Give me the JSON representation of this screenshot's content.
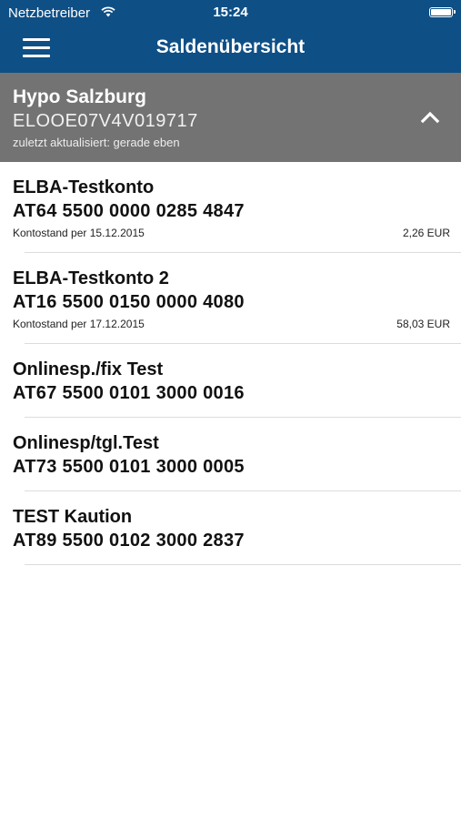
{
  "status_bar": {
    "carrier": "Netzbetreiber",
    "time": "15:24",
    "wifi_icon": "wifi-icon",
    "battery_icon": "battery-icon"
  },
  "nav": {
    "title": "Saldenübersicht",
    "menu_icon": "hamburger-menu-icon"
  },
  "bank": {
    "name": "Hypo Salzburg",
    "id": "ELOOE07V4V019717",
    "updated": "zuletzt aktualisiert: gerade eben",
    "collapse_icon": "chevron-up-icon"
  },
  "accounts": [
    {
      "name": "ELBA-Testkonto",
      "iban": "AT64 5500 0000 0285 4847",
      "date_label": "Kontostand per 15.12.2015",
      "amount": "2,26 EUR"
    },
    {
      "name": "ELBA-Testkonto 2",
      "iban": "AT16 5500 0150 0000 4080",
      "date_label": "Kontostand per 17.12.2015",
      "amount": "58,03 EUR"
    },
    {
      "name": "Onlinesp./fix Test",
      "iban": "AT67 5500 0101 3000 0016"
    },
    {
      "name": "Onlinesp/tgl.Test",
      "iban": "AT73 5500 0101 3000 0005"
    },
    {
      "name": "TEST Kaution",
      "iban": "AT89 5500 0102 3000 2837"
    }
  ],
  "colors": {
    "header_blue": "#0e4f86",
    "bank_bar_gray": "#737373",
    "separator": "#dcdcdc"
  }
}
